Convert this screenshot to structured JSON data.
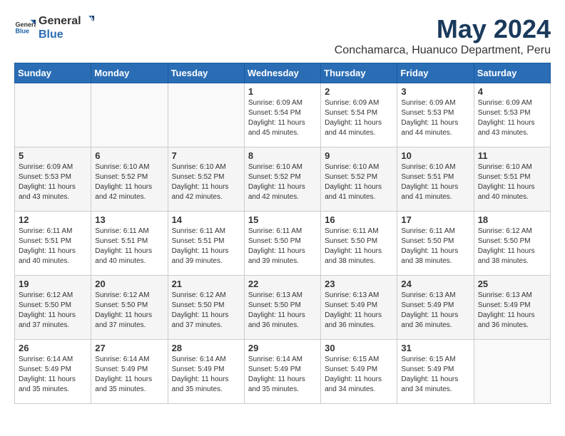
{
  "header": {
    "logo_general": "General",
    "logo_blue": "Blue",
    "title": "May 2024",
    "subtitle": "Conchamarca, Huanuco Department, Peru"
  },
  "weekdays": [
    "Sunday",
    "Monday",
    "Tuesday",
    "Wednesday",
    "Thursday",
    "Friday",
    "Saturday"
  ],
  "weeks": [
    [
      {
        "day": "",
        "sunrise": "",
        "sunset": "",
        "daylight": ""
      },
      {
        "day": "",
        "sunrise": "",
        "sunset": "",
        "daylight": ""
      },
      {
        "day": "",
        "sunrise": "",
        "sunset": "",
        "daylight": ""
      },
      {
        "day": "1",
        "sunrise": "Sunrise: 6:09 AM",
        "sunset": "Sunset: 5:54 PM",
        "daylight": "Daylight: 11 hours and 45 minutes."
      },
      {
        "day": "2",
        "sunrise": "Sunrise: 6:09 AM",
        "sunset": "Sunset: 5:54 PM",
        "daylight": "Daylight: 11 hours and 44 minutes."
      },
      {
        "day": "3",
        "sunrise": "Sunrise: 6:09 AM",
        "sunset": "Sunset: 5:53 PM",
        "daylight": "Daylight: 11 hours and 44 minutes."
      },
      {
        "day": "4",
        "sunrise": "Sunrise: 6:09 AM",
        "sunset": "Sunset: 5:53 PM",
        "daylight": "Daylight: 11 hours and 43 minutes."
      }
    ],
    [
      {
        "day": "5",
        "sunrise": "Sunrise: 6:09 AM",
        "sunset": "Sunset: 5:53 PM",
        "daylight": "Daylight: 11 hours and 43 minutes."
      },
      {
        "day": "6",
        "sunrise": "Sunrise: 6:10 AM",
        "sunset": "Sunset: 5:52 PM",
        "daylight": "Daylight: 11 hours and 42 minutes."
      },
      {
        "day": "7",
        "sunrise": "Sunrise: 6:10 AM",
        "sunset": "Sunset: 5:52 PM",
        "daylight": "Daylight: 11 hours and 42 minutes."
      },
      {
        "day": "8",
        "sunrise": "Sunrise: 6:10 AM",
        "sunset": "Sunset: 5:52 PM",
        "daylight": "Daylight: 11 hours and 42 minutes."
      },
      {
        "day": "9",
        "sunrise": "Sunrise: 6:10 AM",
        "sunset": "Sunset: 5:52 PM",
        "daylight": "Daylight: 11 hours and 41 minutes."
      },
      {
        "day": "10",
        "sunrise": "Sunrise: 6:10 AM",
        "sunset": "Sunset: 5:51 PM",
        "daylight": "Daylight: 11 hours and 41 minutes."
      },
      {
        "day": "11",
        "sunrise": "Sunrise: 6:10 AM",
        "sunset": "Sunset: 5:51 PM",
        "daylight": "Daylight: 11 hours and 40 minutes."
      }
    ],
    [
      {
        "day": "12",
        "sunrise": "Sunrise: 6:11 AM",
        "sunset": "Sunset: 5:51 PM",
        "daylight": "Daylight: 11 hours and 40 minutes."
      },
      {
        "day": "13",
        "sunrise": "Sunrise: 6:11 AM",
        "sunset": "Sunset: 5:51 PM",
        "daylight": "Daylight: 11 hours and 40 minutes."
      },
      {
        "day": "14",
        "sunrise": "Sunrise: 6:11 AM",
        "sunset": "Sunset: 5:51 PM",
        "daylight": "Daylight: 11 hours and 39 minutes."
      },
      {
        "day": "15",
        "sunrise": "Sunrise: 6:11 AM",
        "sunset": "Sunset: 5:50 PM",
        "daylight": "Daylight: 11 hours and 39 minutes."
      },
      {
        "day": "16",
        "sunrise": "Sunrise: 6:11 AM",
        "sunset": "Sunset: 5:50 PM",
        "daylight": "Daylight: 11 hours and 38 minutes."
      },
      {
        "day": "17",
        "sunrise": "Sunrise: 6:11 AM",
        "sunset": "Sunset: 5:50 PM",
        "daylight": "Daylight: 11 hours and 38 minutes."
      },
      {
        "day": "18",
        "sunrise": "Sunrise: 6:12 AM",
        "sunset": "Sunset: 5:50 PM",
        "daylight": "Daylight: 11 hours and 38 minutes."
      }
    ],
    [
      {
        "day": "19",
        "sunrise": "Sunrise: 6:12 AM",
        "sunset": "Sunset: 5:50 PM",
        "daylight": "Daylight: 11 hours and 37 minutes."
      },
      {
        "day": "20",
        "sunrise": "Sunrise: 6:12 AM",
        "sunset": "Sunset: 5:50 PM",
        "daylight": "Daylight: 11 hours and 37 minutes."
      },
      {
        "day": "21",
        "sunrise": "Sunrise: 6:12 AM",
        "sunset": "Sunset: 5:50 PM",
        "daylight": "Daylight: 11 hours and 37 minutes."
      },
      {
        "day": "22",
        "sunrise": "Sunrise: 6:13 AM",
        "sunset": "Sunset: 5:50 PM",
        "daylight": "Daylight: 11 hours and 36 minutes."
      },
      {
        "day": "23",
        "sunrise": "Sunrise: 6:13 AM",
        "sunset": "Sunset: 5:49 PM",
        "daylight": "Daylight: 11 hours and 36 minutes."
      },
      {
        "day": "24",
        "sunrise": "Sunrise: 6:13 AM",
        "sunset": "Sunset: 5:49 PM",
        "daylight": "Daylight: 11 hours and 36 minutes."
      },
      {
        "day": "25",
        "sunrise": "Sunrise: 6:13 AM",
        "sunset": "Sunset: 5:49 PM",
        "daylight": "Daylight: 11 hours and 36 minutes."
      }
    ],
    [
      {
        "day": "26",
        "sunrise": "Sunrise: 6:14 AM",
        "sunset": "Sunset: 5:49 PM",
        "daylight": "Daylight: 11 hours and 35 minutes."
      },
      {
        "day": "27",
        "sunrise": "Sunrise: 6:14 AM",
        "sunset": "Sunset: 5:49 PM",
        "daylight": "Daylight: 11 hours and 35 minutes."
      },
      {
        "day": "28",
        "sunrise": "Sunrise: 6:14 AM",
        "sunset": "Sunset: 5:49 PM",
        "daylight": "Daylight: 11 hours and 35 minutes."
      },
      {
        "day": "29",
        "sunrise": "Sunrise: 6:14 AM",
        "sunset": "Sunset: 5:49 PM",
        "daylight": "Daylight: 11 hours and 35 minutes."
      },
      {
        "day": "30",
        "sunrise": "Sunrise: 6:15 AM",
        "sunset": "Sunset: 5:49 PM",
        "daylight": "Daylight: 11 hours and 34 minutes."
      },
      {
        "day": "31",
        "sunrise": "Sunrise: 6:15 AM",
        "sunset": "Sunset: 5:49 PM",
        "daylight": "Daylight: 11 hours and 34 minutes."
      },
      {
        "day": "",
        "sunrise": "",
        "sunset": "",
        "daylight": ""
      }
    ]
  ]
}
